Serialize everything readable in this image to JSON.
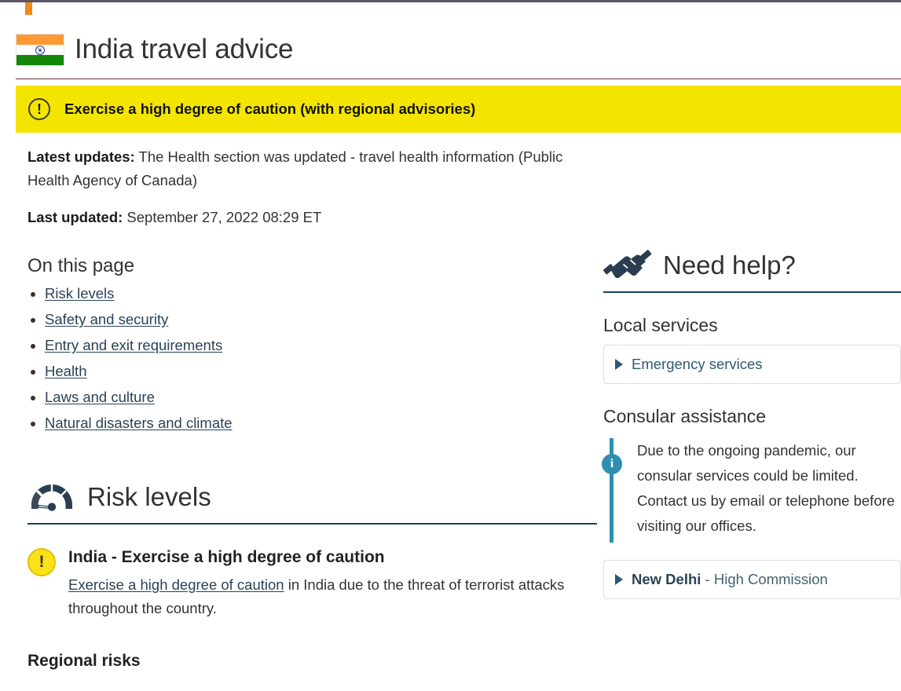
{
  "topbar": {
    "accent_purple": "#5a5464",
    "accent_orange": "#f5871f"
  },
  "header": {
    "flag_icon": "india-flag-icon",
    "title": "India travel advice",
    "rule_color": "#6b2d2d"
  },
  "alert_banner": {
    "icon": "exclamation-circle-icon",
    "icon_glyph": "!",
    "text": "Exercise a high degree of caution (with regional advisories)",
    "background": "#f4e500"
  },
  "updates": {
    "latest_label": "Latest updates:",
    "latest_text": " The Health section was updated - travel health information (Public Health Agency of Canada)",
    "last_updated_label": "Last updated:",
    "last_updated_value": " September 27, 2022 08:29 ET"
  },
  "on_this_page": {
    "heading": "On this page",
    "links": [
      {
        "label": "Risk levels"
      },
      {
        "label": "Safety and security"
      },
      {
        "label": "Entry and exit requirements"
      },
      {
        "label": "Health"
      },
      {
        "label": "Laws and culture"
      },
      {
        "label": "Natural disasters and climate"
      }
    ]
  },
  "risk_levels": {
    "icon": "gauge-icon",
    "heading": "Risk levels",
    "rule_color": "#15445c",
    "alert": {
      "icon": "exclamation-circle-icon",
      "icon_glyph": "!",
      "title": "India - Exercise a high degree of caution",
      "link_text": "Exercise a high degree of caution",
      "body_rest": " in India due to the threat of terrorist attacks throughout the country."
    },
    "regional_heading": "Regional risks"
  },
  "sidebar": {
    "icon": "handshake-icon",
    "heading": "Need help?",
    "rule_color": "#15445c",
    "local_services": {
      "heading": "Local services",
      "items": [
        {
          "label": "Emergency services",
          "expanded": false
        }
      ]
    },
    "consular_assistance": {
      "heading": "Consular assistance",
      "callout": {
        "icon": "info-circle-icon",
        "icon_glyph": "i",
        "accent_color": "#2f8fb0",
        "text": "Due to the ongoing pandemic, our consular services could be limited. Contact us by email or telephone before visiting our offices."
      },
      "items": [
        {
          "name": "New Delhi",
          "suffix": " - High Commission",
          "expanded": false
        }
      ]
    }
  }
}
